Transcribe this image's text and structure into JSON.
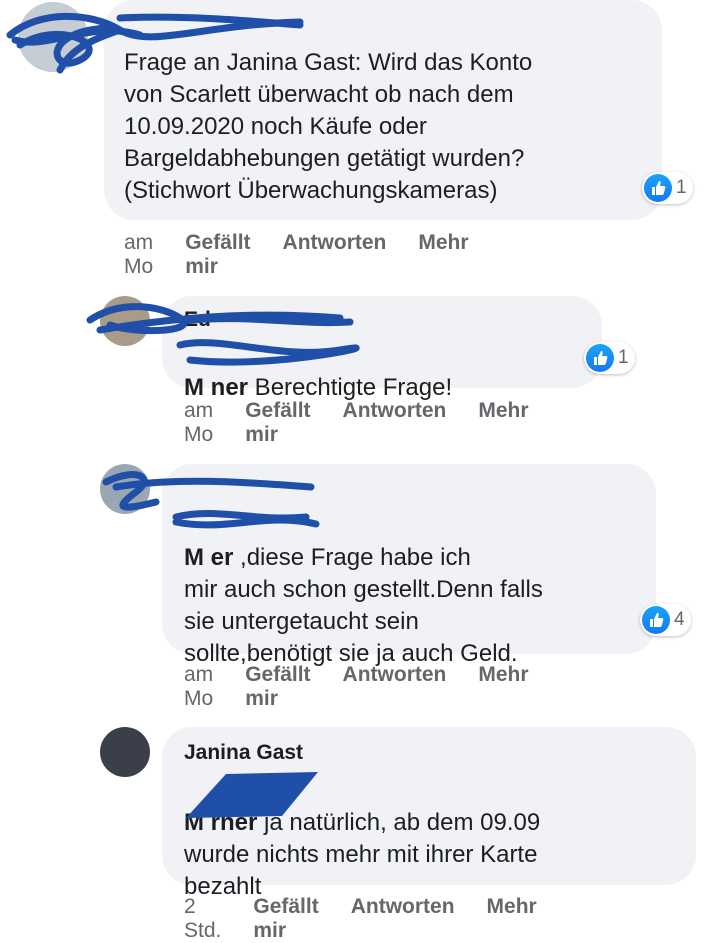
{
  "comments": [
    {
      "author": "",
      "mention": "",
      "text": "Frage an Janina Gast: Wird das Konto\nvon Scarlett überwacht ob nach dem\n10.09.2020 noch Käufe oder\nBargeldabhebungen getätigt wurden?\n(Stichwort Überwachungskameras)",
      "likes": "1",
      "time": "am Mo",
      "like_label": "Gefällt mir",
      "reply_label": "Antworten",
      "more_label": "Mehr"
    },
    {
      "author": "Ed",
      "mention": "M     ner",
      "text": " Berechtigte Frage!",
      "likes": "1",
      "time": "am Mo",
      "like_label": "Gefällt mir",
      "reply_label": "Antworten",
      "more_label": "Mehr"
    },
    {
      "author": "",
      "mention": "M        er",
      "text": " ,diese Frage habe ich\nmir auch schon gestellt.Denn falls\nsie untergetaucht sein\nsollte,benötigt sie ja auch Geld.",
      "likes": "4",
      "time": "am Mo",
      "like_label": "Gefällt mir",
      "reply_label": "Antworten",
      "more_label": "Mehr"
    },
    {
      "author": "Janina Gast",
      "mention": "M       rner",
      "text": " ja natürlich, ab dem 09.09\nwurde nichts mehr mit ihrer Karte\nbezahlt",
      "time": "2 Std.",
      "like_label": "Gefällt mir",
      "reply_label": "Antworten",
      "more_label": "Mehr"
    }
  ],
  "colors": {
    "bubble": "#f0f2f5",
    "meta": "#65676b",
    "like_blue": "#1877f2",
    "redaction": "#1f4fa8"
  },
  "icons": {
    "reaction": "thumbs-up-icon"
  }
}
